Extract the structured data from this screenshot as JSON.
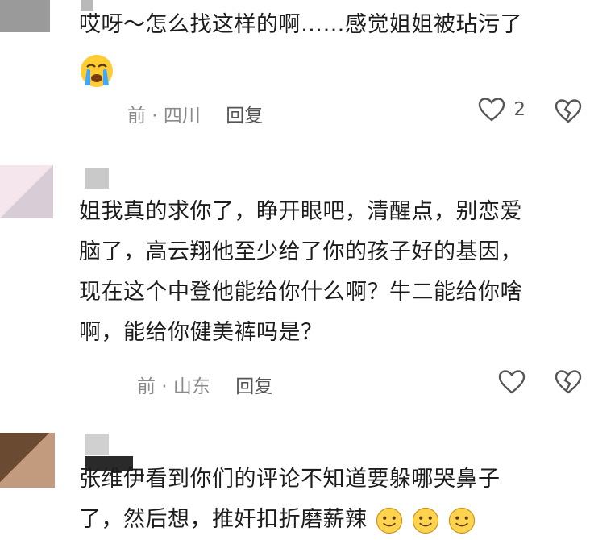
{
  "comments": [
    {
      "text": "哎呀～怎么找这样的啊……感觉姐姐被玷污了",
      "meta": "前 · 四川",
      "reply": "回复",
      "likes": "2"
    },
    {
      "lines": [
        "姐我真的求你了，睁开眼吧，清醒点，别恋爱",
        "脑了，高云翔他至少给了你的孩子好的基因，",
        "现在这个中登他能给你什么啊？牛二能给你啥",
        "啊，能给你健美裤吗是？"
      ],
      "meta": "前 · 山东",
      "reply": "回复"
    },
    {
      "lines": [
        "张维伊看到你们的评论不知道要躲哪哭鼻子",
        "了，然后想，推奸扣折磨薪辣"
      ]
    }
  ]
}
